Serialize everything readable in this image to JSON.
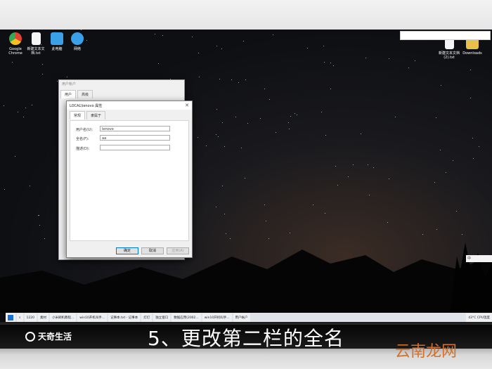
{
  "desktop": {
    "icons": [
      {
        "label": "Google Chrome",
        "icon": "chrome-icon",
        "color": "#e34133"
      },
      {
        "label": "新建文本文 档.txt",
        "icon": "text-file-icon",
        "color": "#ffffff"
      },
      {
        "label": "此电脑",
        "icon": "computer-icon",
        "color": "#3aa0e8"
      },
      {
        "label": "网络",
        "icon": "network-icon",
        "color": "#3aa0e8"
      }
    ],
    "right_icons": [
      {
        "label": "新建文本文档 (2).txt",
        "icon": "text-file-icon"
      },
      {
        "label": "Downloads",
        "icon": "folder-icon"
      }
    ]
  },
  "back_window": {
    "title": "用户帐户",
    "tabs": [
      "用户",
      "高级"
    ]
  },
  "dialog": {
    "title": "LOCAL\\lenovo 属性",
    "tabs": [
      "常规",
      "隶属于"
    ],
    "fields": [
      {
        "label": "用户名(U):",
        "value": "lenovo"
      },
      {
        "label": "全名(F):",
        "value": "aa"
      },
      {
        "label": "描述(D):",
        "value": ""
      }
    ],
    "buttons": {
      "ok": "确定",
      "cancel": "取消",
      "apply": "应用(A)"
    }
  },
  "taskbar": {
    "items": [
      "1220",
      "素材",
      "小米刷机教程...",
      "win10开机叫手...",
      "记事本.txt - 记事本",
      "灯灯",
      "独立窗口",
      "数据应用(2002...",
      "win10开机叫手...",
      "用户帐户"
    ],
    "tray": [
      "43°C CPU温度"
    ]
  },
  "ime": {
    "label": "中"
  },
  "caption": {
    "text": "5、更改第二栏的全名",
    "logo_text": "天奇生活"
  },
  "watermark": {
    "text": "云南龙网"
  },
  "colors": {
    "accent": "#0078d7",
    "watermark": "#d2702a"
  }
}
